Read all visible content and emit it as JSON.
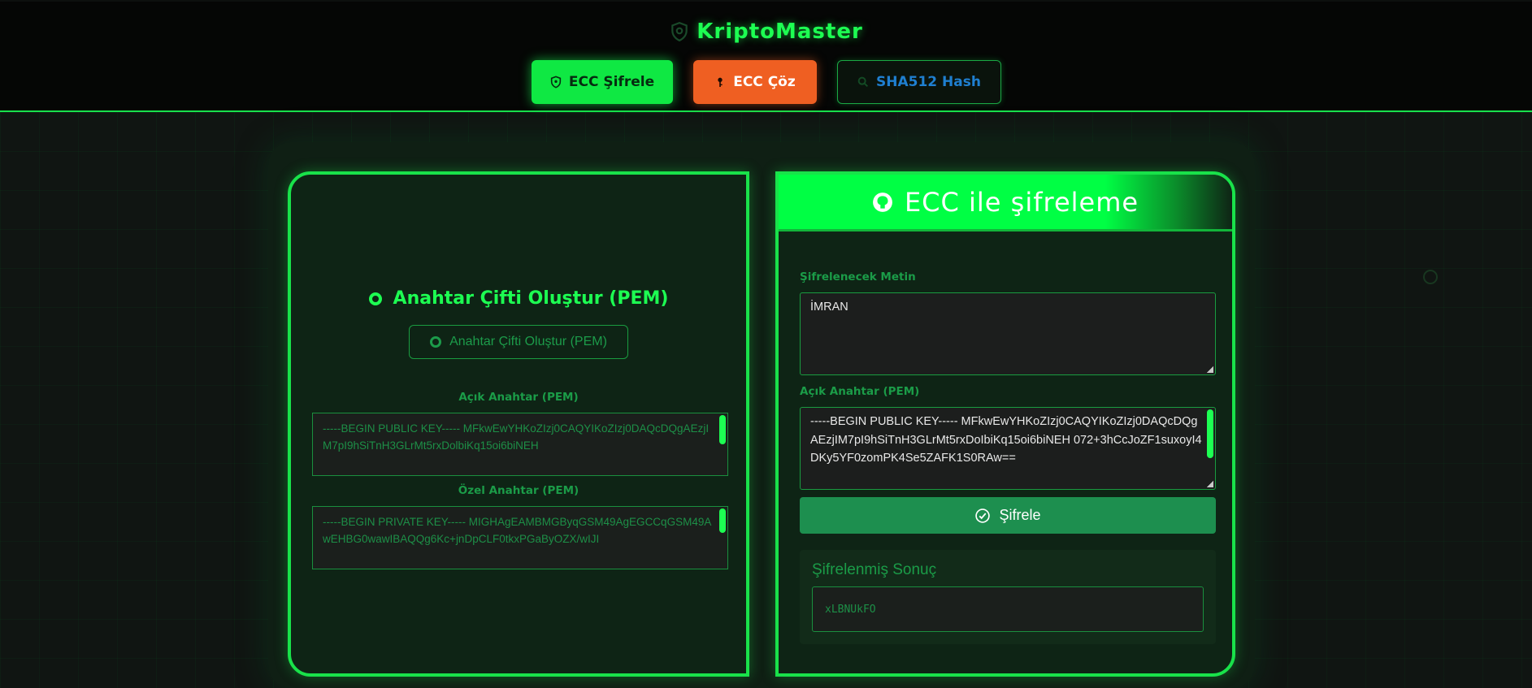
{
  "app": {
    "title": "KriptoMaster"
  },
  "tabs": [
    {
      "label": "ECC Şifrele",
      "icon": "shield-icon",
      "state": "active"
    },
    {
      "label": "ECC Çöz",
      "icon": "key-icon",
      "state": "secondary"
    },
    {
      "label": "SHA512 Hash",
      "icon": "search-icon",
      "state": "inactive"
    }
  ],
  "left_panel": {
    "heading": "Anahtar Çifti Oluştur (PEM)",
    "generate_button": "Anahtar Çifti Oluştur (PEM)",
    "public_key_label": "Açık Anahtar (PEM)",
    "public_key_value": "-----BEGIN PUBLIC KEY----- MFkwEwYHKoZIzj0CAQYIKoZIzj0DAQcDQgAEzjIM7pI9hSiTnH3GLrMt5rxDolbiKq15oi6biNEH",
    "private_key_label": "Özel Anahtar (PEM)",
    "private_key_value": "-----BEGIN PRIVATE KEY----- MIGHAgEAMBMGByqGSM49AgEGCCqGSM49AwEHBG0wawIBAQQg6Kc+jnDpCLF0tkxPGaByOZX/wIJI"
  },
  "right_panel": {
    "title": "ECC ile şifreleme",
    "plaintext_label": "Şifrelenecek Metin",
    "plaintext_value": "İMRAN",
    "public_key_label": "Açık Anahtar (PEM)",
    "public_key_value": "-----BEGIN PUBLIC KEY----- MFkwEwYHKoZIzj0CAQYIKoZIzj0DAQcDQgAEzjIM7pI9hSiTnH3GLrMt5rxDoIbiKq15oi6biNEH 072+3hCcJoZF1suxoyI4DKy5YF0zomPK4Se5ZAFK1S0RAw==",
    "encrypt_button": "Şifrele",
    "result_title": "Şifrelenmiş Sonuç",
    "result_value": "xLBNUkFO"
  },
  "colors": {
    "accent": "#1dff52",
    "decrypt": "#ef5f22",
    "hash_text": "#1f7fd0",
    "button": "#1d8f4f"
  }
}
